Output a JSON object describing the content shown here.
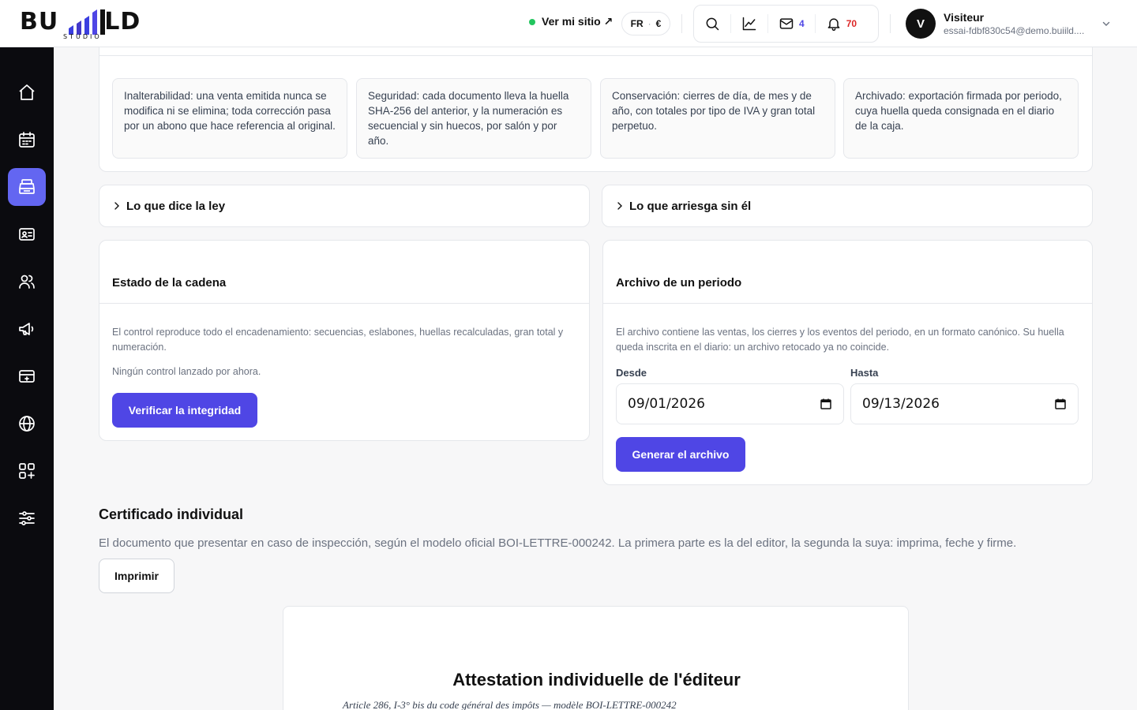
{
  "brand": {
    "word_left": "BU",
    "word_right": "LD",
    "subtitle": "STUDIO"
  },
  "header": {
    "site_link": "Ver mi sitio ↗",
    "lang": "FR",
    "currency": "€",
    "mail_count": "4",
    "notif_count": "70",
    "user": {
      "initial": "V",
      "name": "Visiteur",
      "email": "essai-fdbf830c54@demo.buiild...."
    }
  },
  "colors": {
    "accent": "#4f46e5",
    "sidebar_active": "#6366f1",
    "online": "#22c55e",
    "alert": "#dc2626"
  },
  "sidebar": {
    "items": [
      {
        "icon": "home-icon"
      },
      {
        "icon": "calendar-icon"
      },
      {
        "icon": "register-icon",
        "active": true
      },
      {
        "icon": "contact-card-icon"
      },
      {
        "icon": "users-icon"
      },
      {
        "icon": "megaphone-icon"
      },
      {
        "icon": "payment-card-icon"
      },
      {
        "icon": "globe-icon"
      },
      {
        "icon": "apps-icon"
      },
      {
        "icon": "settings-sliders-icon"
      }
    ]
  },
  "principles": [
    "Inalterabilidad: una venta emitida nunca se modifica ni se elimina; toda corrección pasa por un abono que hace referencia al original.",
    "Seguridad: cada documento lleva la huella SHA-256 del anterior, y la numeración es secuencial y sin huecos, por salón y por año.",
    "Conservación: cierres de día, de mes y de año, con totales por tipo de IVA y gran total perpetuo.",
    "Archivado: exportación firmada por periodo, cuya huella queda consignada en el diario de la caja."
  ],
  "accordions": {
    "law": "Lo que dice la ley",
    "risk": "Lo que arriesga sin él"
  },
  "chain": {
    "title": "Estado de la cadena",
    "description": "El control reproduce todo el encadenamiento: secuencias, eslabones, huellas recalculadas, gran total y numeración.",
    "status": "Ningún control lanzado por ahora.",
    "button": "Verificar la integridad"
  },
  "archive": {
    "title": "Archivo de un periodo",
    "description": "El archivo contiene las ventas, los cierres y los eventos del periodo, en un formato canónico. Su huella queda inscrita en el diario: un archivo retocado ya no coincide.",
    "from_label": "Desde",
    "from_value": "09/01/2026",
    "to_label": "Hasta",
    "to_value": "09/13/2026",
    "button": "Generar el archivo"
  },
  "certificate": {
    "title": "Certificado individual",
    "description": "El documento que presentar en caso de inspección, según el modelo oficial BOI-LETTRE-000242. La primera parte es la del editor, la segunda la suya: imprima, feche y firme.",
    "print_button": "Imprimir",
    "doc_title": "Attestation individuelle de l'éditeur",
    "doc_subtitle": "Article 286, I-3° bis du code général des impôts — modèle BOI-LETTRE-000242"
  }
}
